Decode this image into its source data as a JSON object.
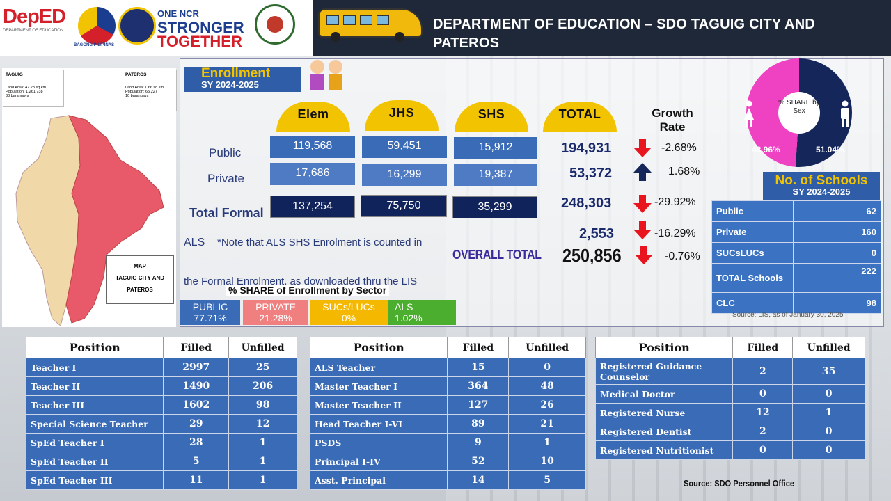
{
  "header": {
    "title": "DEPARTMENT OF EDUCATION – SDO TAGUIG CITY AND PATEROS",
    "logos": {
      "deped": "DepED",
      "deped_sub": "DEPARTMENT OF EDUCATION",
      "bagong": "BAGONG PILIPINAS",
      "ncr_line1": "ONE NCR",
      "ncr_line2": "STRONGER",
      "ncr_line3": "TOGETHER"
    }
  },
  "map": {
    "taguig": {
      "name": "TAGUIG",
      "land_area": "Land Area:   47.28 sq km",
      "population": "Population:  1,261,738",
      "barangays": "38 barangays"
    },
    "pateros": {
      "name": "PATEROS",
      "land_area": "Land Area:   1.66 sq km",
      "population": "Population:  65,227",
      "barangays": "10 barangays"
    },
    "legend_title": "MAP",
    "legend_text": "TAGUIG CITY AND PATEROS",
    "colors": {
      "taguig": "#f0d8a8",
      "pateros": "#e85a6a"
    }
  },
  "enrollment": {
    "title": "Enrollment",
    "sy": "SY 2024-2025",
    "columns": [
      "Elem",
      "JHS",
      "SHS",
      "TOTAL"
    ],
    "growth_header": "Growth Rate",
    "rows": [
      {
        "label": "Public",
        "elem": "119,568",
        "jhs": "59,451",
        "shs": "15,912",
        "total": "194,931",
        "growth": "-2.68%",
        "trend": "down"
      },
      {
        "label": "Private",
        "elem": "17,686",
        "jhs": "16,299",
        "shs": "19,387",
        "total": "53,372",
        "growth": "1.68%",
        "trend": "up"
      },
      {
        "label": "Total Formal",
        "elem": "137,254",
        "jhs": "75,750",
        "shs": "35,299",
        "total": "248,303",
        "growth": "-29.92%",
        "trend": "down"
      }
    ],
    "als": {
      "label": "ALS",
      "total": "2,553",
      "growth": "-16.29%",
      "trend": "down"
    },
    "note_line1": "*Note that ALS SHS Enrolment is counted in",
    "note_line2": "the Formal Enrolment, as downloaded thru the LIS",
    "overall": {
      "label": "OVERALL TOTAL",
      "total": "250,856",
      "growth": "-0.76%",
      "trend": "down"
    }
  },
  "share_sector": {
    "title": "% SHARE of Enrollment by Sector",
    "items": [
      {
        "label": "PUBLIC",
        "value": "77.71%",
        "color": "#3a6bb6",
        "text_color": "#ffffff"
      },
      {
        "label": "PRIVATE",
        "value": "21.28%",
        "color": "#f08080",
        "text_color": "#ffffff"
      },
      {
        "label": "SUCs/LUCs",
        "value": "0%",
        "color": "#f5b800",
        "text_color": "#ffffff"
      },
      {
        "label": "ALS",
        "value": "1.02%",
        "color": "#4cae2f",
        "text_color": "#ffffff"
      }
    ]
  },
  "share_sex": {
    "center_label": "% SHARE by Sex",
    "female": "48.96%",
    "male": "51.04%",
    "female_color": "#ee42c3",
    "male_color": "#15265a"
  },
  "schools": {
    "title": "No. of Schools",
    "sy": "SY 2024-2025",
    "rows": [
      {
        "label": "Public",
        "value": "62"
      },
      {
        "label": "Private",
        "value": "160"
      },
      {
        "label": "SUCsLUCs",
        "value": "0"
      },
      {
        "label": "TOTAL Schools",
        "value": "222"
      },
      {
        "label": "CLC",
        "value": "98"
      }
    ],
    "source": "Source: LIS, as of January 30, 2025"
  },
  "positions": {
    "headers": {
      "position": "Position",
      "filled": "Filled",
      "unfilled": "Unfilled"
    },
    "table1": [
      {
        "name": "Teacher I",
        "filled": "2997",
        "unfilled": "25"
      },
      {
        "name": "Teacher II",
        "filled": "1490",
        "unfilled": "206"
      },
      {
        "name": "Teacher III",
        "filled": "1602",
        "unfilled": "98"
      },
      {
        "name": "Special Science Teacher",
        "filled": "29",
        "unfilled": "12"
      },
      {
        "name": "SpEd Teacher I",
        "filled": "28",
        "unfilled": "1"
      },
      {
        "name": "SpEd Teacher II",
        "filled": "5",
        "unfilled": "1"
      },
      {
        "name": "SpEd Teacher III",
        "filled": "11",
        "unfilled": "1"
      }
    ],
    "table2": [
      {
        "name": "ALS Teacher",
        "filled": "15",
        "unfilled": "0"
      },
      {
        "name": "Master Teacher I",
        "filled": "364",
        "unfilled": "48"
      },
      {
        "name": "Master Teacher II",
        "filled": "127",
        "unfilled": "26"
      },
      {
        "name": "Head Teacher I-VI",
        "filled": "89",
        "unfilled": "21"
      },
      {
        "name": "PSDS",
        "filled": "9",
        "unfilled": "1"
      },
      {
        "name": "Principal I-IV",
        "filled": "52",
        "unfilled": "10"
      },
      {
        "name": "Asst. Principal",
        "filled": "14",
        "unfilled": "5"
      }
    ],
    "table3": [
      {
        "name": "Registered Guidance Counselor",
        "filled": "2",
        "unfilled": "35"
      },
      {
        "name": "Medical Doctor",
        "filled": "0",
        "unfilled": "0"
      },
      {
        "name": "Registered Nurse",
        "filled": "12",
        "unfilled": "1"
      },
      {
        "name": "Registered Dentist",
        "filled": "2",
        "unfilled": "0"
      },
      {
        "name": "Registered Nutritionist",
        "filled": "0",
        "unfilled": "0"
      }
    ],
    "source": "Source:  SDO Personnel Office"
  }
}
